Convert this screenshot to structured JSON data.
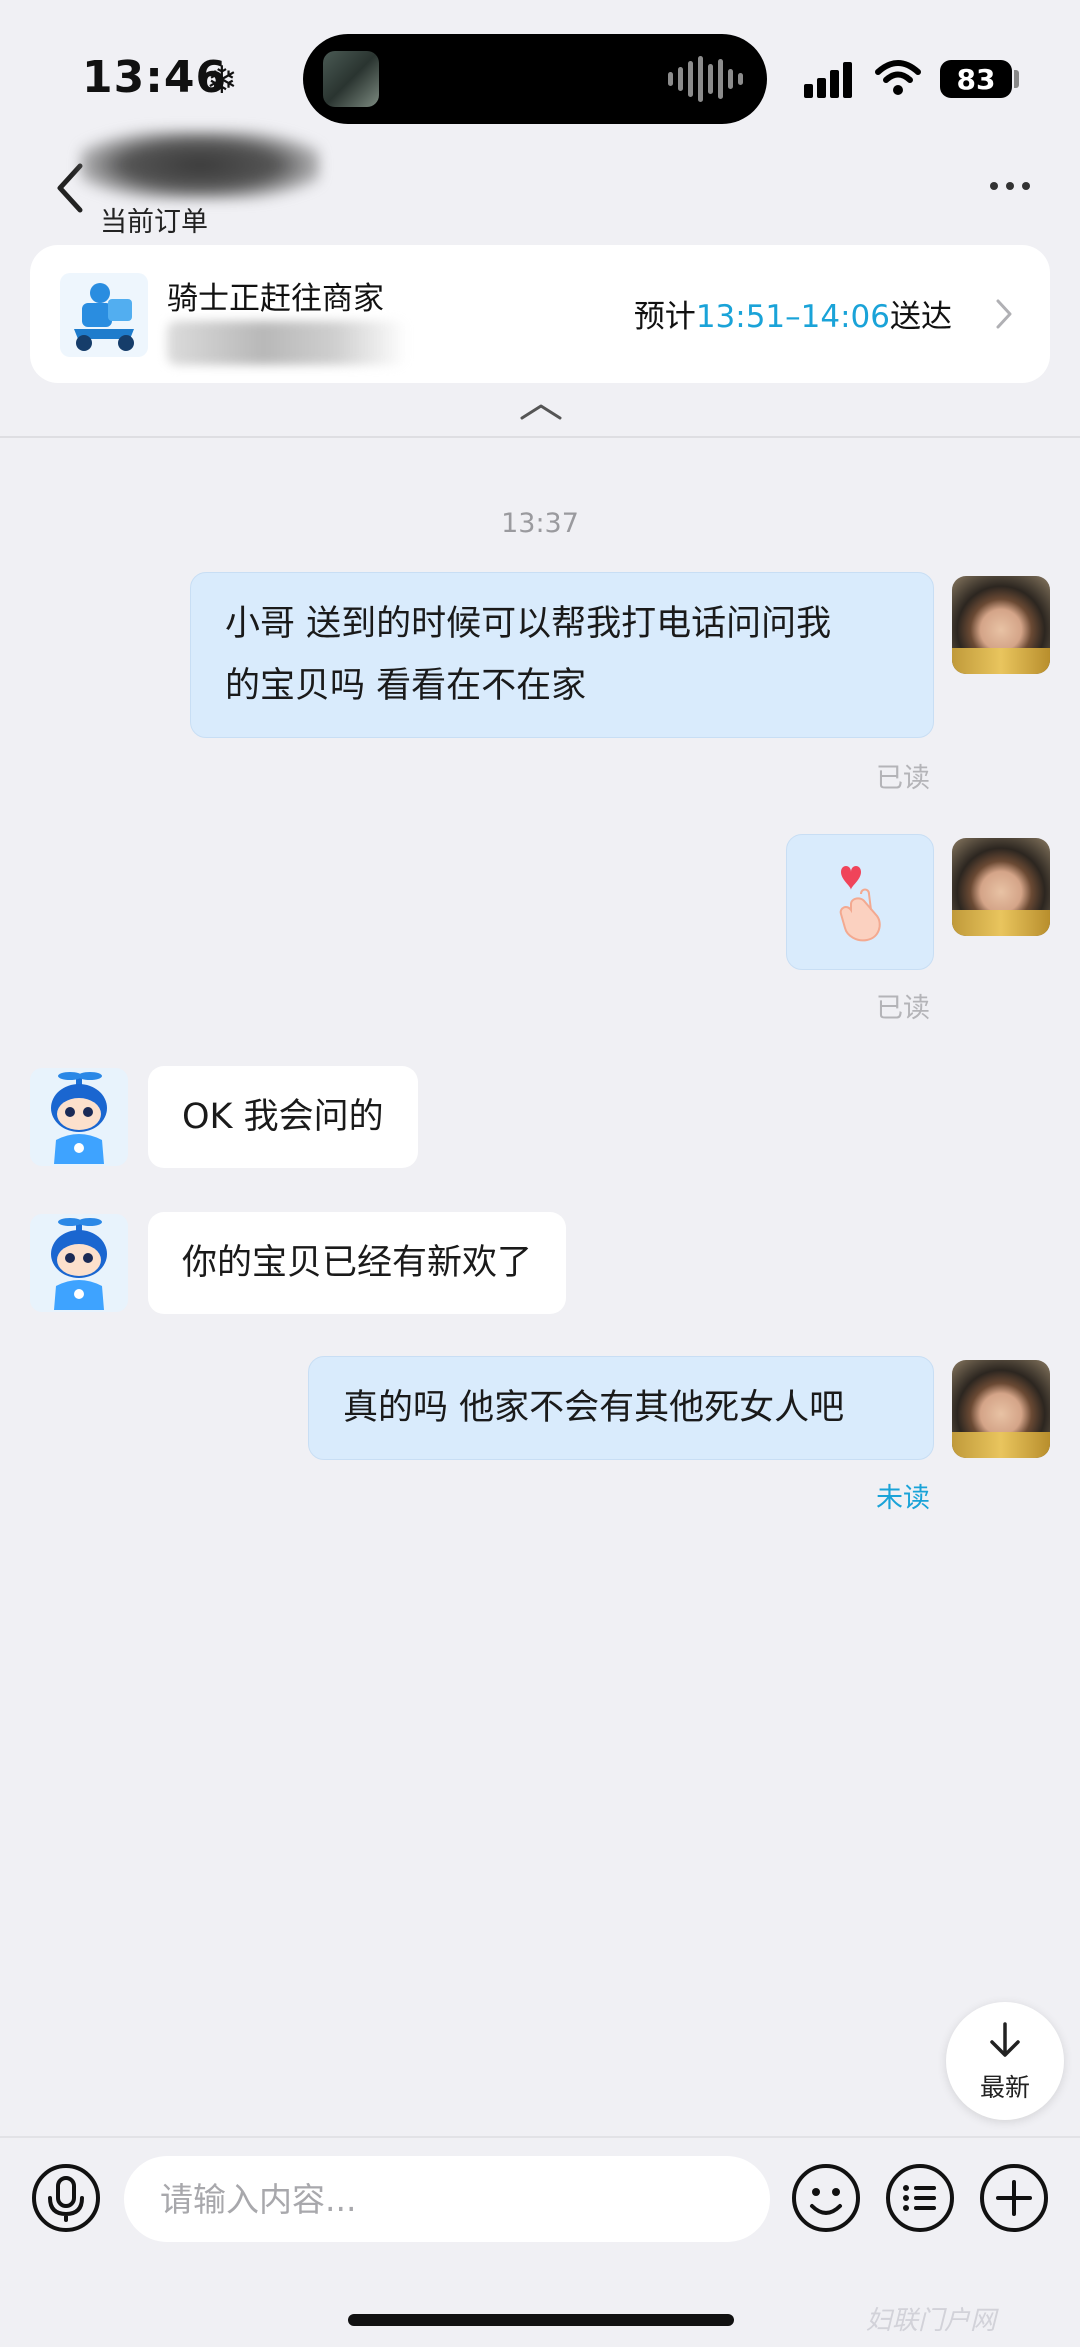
{
  "status_bar": {
    "time": "13:46",
    "battery": "83"
  },
  "header": {
    "subtitle": "当前订单"
  },
  "order": {
    "title": "骑士正赶往商家",
    "eta_prefix": "预计",
    "eta_time": "13:51–14:06",
    "eta_suffix": "送达"
  },
  "chat": {
    "timestamp": "13:37",
    "messages": [
      {
        "sender": "me",
        "lines": [
          "小哥 送到的时候可以帮我打电话问问我",
          "的宝贝吗 看看在不在家"
        ],
        "status": "已读"
      },
      {
        "sender": "me",
        "sticker": "finger-heart-icon",
        "status": "已读"
      },
      {
        "sender": "rider",
        "text": "OK 我会问的"
      },
      {
        "sender": "rider",
        "text": "你的宝贝已经有新欢了"
      },
      {
        "sender": "me",
        "text": "真的吗 他家不会有其他死女人吧",
        "status": "未读"
      }
    ]
  },
  "latest_button": {
    "label": "最新"
  },
  "input": {
    "placeholder": "请输入内容..."
  },
  "watermark": "妇联门户网",
  "colors": {
    "accent": "#1aa3d8",
    "bubble_me": "#d9ebfc",
    "background": "#f0f0f4"
  }
}
